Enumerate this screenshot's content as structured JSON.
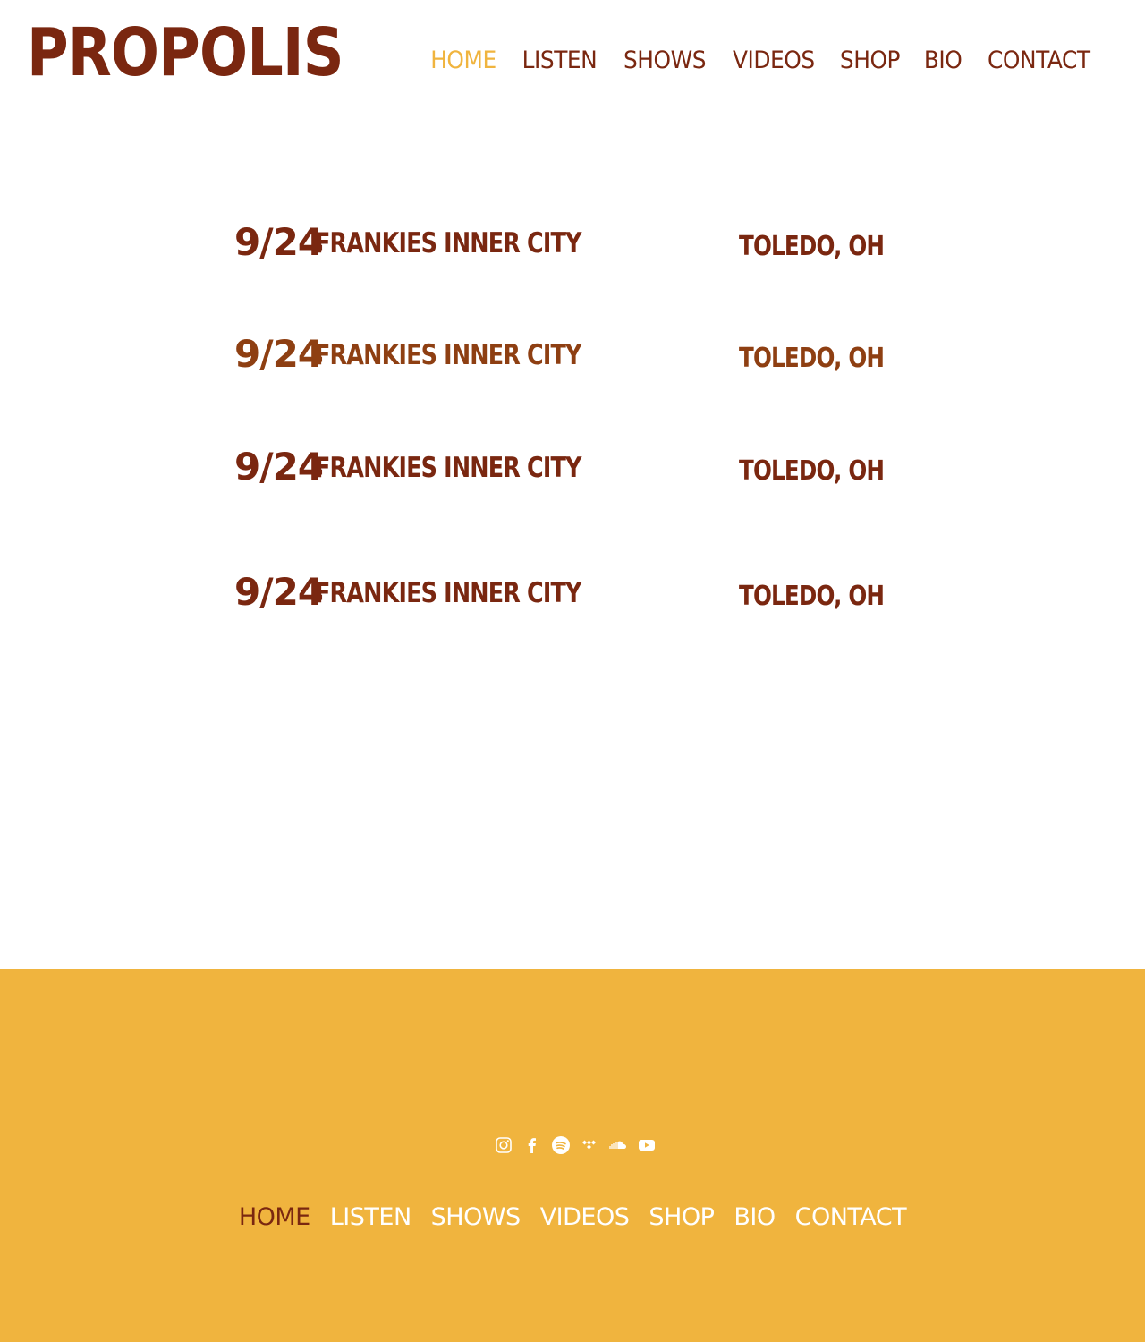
{
  "header": {
    "logo": "PROPOLIS",
    "nav": [
      "HOME",
      "LISTEN",
      "SHOWS",
      "VIDEOS",
      "SHOP",
      "BIO",
      "CONTACT"
    ],
    "active": "HOME"
  },
  "shows": [
    {
      "date": "9/24",
      "venue": "FRANKIES INNER CITY",
      "location": "TOLEDO, OH"
    },
    {
      "date": "9/24",
      "venue": "FRANKIES INNER CITY",
      "location": "TOLEDO, OH"
    },
    {
      "date": "9/24",
      "venue": "FRANKIES INNER CITY",
      "location": "TOLEDO, OH"
    },
    {
      "date": "9/24",
      "venue": "FRANKIES INNER CITY",
      "location": "TOLEDO, OH"
    }
  ],
  "footer": {
    "social_icons": [
      "instagram-icon",
      "facebook-icon",
      "spotify-icon",
      "tidal-icon",
      "soundcloud-icon",
      "youtube-icon"
    ],
    "nav": [
      "HOME",
      "LISTEN",
      "SHOWS",
      "VIDEOS",
      "SHOP",
      "BIO",
      "CONTACT"
    ]
  },
  "colors": {
    "brand": "#7a2710",
    "accent": "#f0b43e",
    "footer_bg": "#f0b43e"
  }
}
